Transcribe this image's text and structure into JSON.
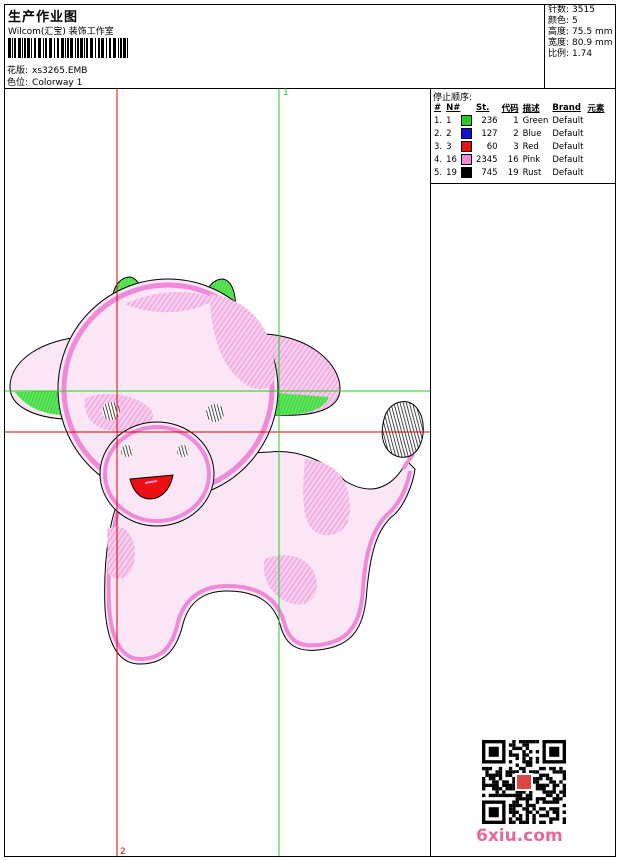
{
  "header": {
    "title": "生产作业图",
    "subtitle": "Wilcom(汇宝) 装饰工作室",
    "design_label": "花版:",
    "design_value": "xs3265.EMB",
    "colorway_label": "色位:",
    "colorway_value": "Colorway 1"
  },
  "stats": [
    {
      "label": "针数:",
      "value": "3515"
    },
    {
      "label": "颜色:",
      "value": "5"
    },
    {
      "label": "高度:",
      "value": "75.5 mm"
    },
    {
      "label": "宽度:",
      "value": "80.9 mm"
    },
    {
      "label": "比例:",
      "value": "1.74"
    }
  ],
  "stop_sequence": {
    "title": "停止顺序:",
    "headers": [
      "#",
      "N#",
      "St.",
      "代码",
      "描述",
      "Brand",
      "元素"
    ],
    "rows": [
      {
        "idx": "1.",
        "n": "1",
        "color": "#22cc22",
        "st": "236",
        "code": "1",
        "desc": "Green",
        "brand": "Default"
      },
      {
        "idx": "2.",
        "n": "2",
        "color": "#1010dd",
        "st": "127",
        "code": "2",
        "desc": "Blue",
        "brand": "Default"
      },
      {
        "idx": "3.",
        "n": "3",
        "color": "#ee1010",
        "st": "60",
        "code": "3",
        "desc": "Red",
        "brand": "Default"
      },
      {
        "idx": "4.",
        "n": "16",
        "color": "#f08ad8",
        "st": "2345",
        "code": "16",
        "desc": "Pink",
        "brand": "Default"
      },
      {
        "idx": "5.",
        "n": "19",
        "color": "#000000",
        "st": "745",
        "code": "19",
        "desc": "Rust",
        "brand": "Default"
      }
    ]
  },
  "guides": {
    "label_1": "1",
    "label_2": "2"
  },
  "colors": {
    "pink": "#f08ad8",
    "green": "#22cc22",
    "red_guide": "#dd0000",
    "green_guide": "#22cc22",
    "brand_pink": "#e8689a"
  },
  "footer": {
    "brand": "6xiu.com"
  }
}
